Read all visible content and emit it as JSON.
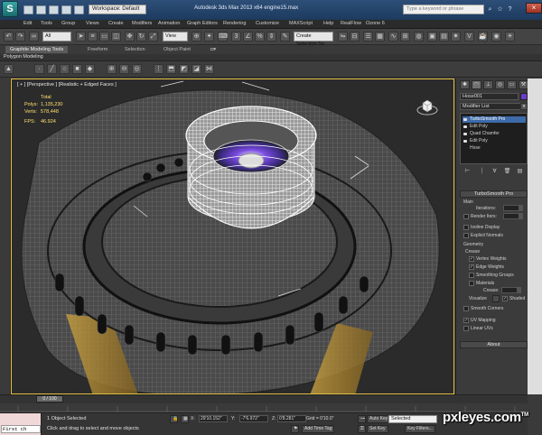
{
  "titlebar": {
    "logo": "S",
    "workspace": "Workspace: Default",
    "title": "Autodesk 3ds Max 2013 x64   engine15.max",
    "search_placeholder": "Type a keyword or phrase"
  },
  "menu": [
    "Edit",
    "Tools",
    "Group",
    "Views",
    "Create",
    "Modifiers",
    "Animation",
    "Graph Editors",
    "Rendering",
    "Customize",
    "MAXScript",
    "Help",
    "RealFlow",
    "Ozone 6"
  ],
  "toolbar": {
    "filter": "All",
    "view": "View",
    "create_selection": "Create Selection Se"
  },
  "ribbon": {
    "tabs": [
      "Graphite Modeling Tools",
      "Freeform",
      "Selection",
      "Object Paint"
    ],
    "subtitle": "Polygon Modeling"
  },
  "viewport": {
    "label": "[ + ] [Perspective ] [Realistic + Edged Faces ]",
    "stats": {
      "total": "Total",
      "polys_label": "Polys:",
      "polys": "1,135,230",
      "verts_label": "Verts:",
      "verts": "578,448",
      "fps_label": "FPS:",
      "fps": "46.924"
    }
  },
  "command_panel": {
    "object_name": "Hose001",
    "modifier_list": "Modifier List",
    "stack": [
      "TurboSmooth Pro",
      "Edit Poly",
      "Quad Chamfer",
      "Edit Poly",
      "Hose"
    ],
    "rollout_title": "TurboSmooth Pro",
    "main_label": "Main",
    "iterations_label": "Iterations:",
    "render_iters_label": "Render Iters:",
    "isoline_display": "Isoline Display",
    "explicit_normals": "Explicit Normals",
    "geometry_label": "Geometry",
    "crease_label": "Crease",
    "vertex_weights": "Vertex Weights",
    "edge_weights": "Edge Weights",
    "smoothing_groups": "Smoothing Groups",
    "materials": "Materials",
    "crease_field": "Crease:",
    "visualize": "Visualize",
    "shaded": "Shaded",
    "smooth_corners": "Smooth Corners",
    "uv_mapping": "UV Mapping",
    "linear_uvs": "Linear UVs",
    "about": "About"
  },
  "timeline": {
    "frame": "0 / 100"
  },
  "status": {
    "maxscript_cmd": "First ch",
    "selection": "1 Object Selected",
    "prompt": "Click and drag to select and move objects",
    "x_label": "X:",
    "x": "29'10.152\"",
    "y_label": "Y:",
    "y": "-7'6.972\"",
    "z_label": "Z:",
    "z": "0'8.281\"",
    "grid": "Grid = 0'10.0\"",
    "auto_key": "Auto Key",
    "set_key": "Set Key",
    "selected": "Selected",
    "key_filters": "Key Filters...",
    "add_time_tag": "Add Time Tag"
  },
  "watermark": {
    "text": "pxleyes.com",
    "tm": "TM"
  },
  "colors": {
    "viewport_border": "#e0c040",
    "object_color": "#6a3ac8",
    "selected_modifier": "#3d6aa8"
  }
}
